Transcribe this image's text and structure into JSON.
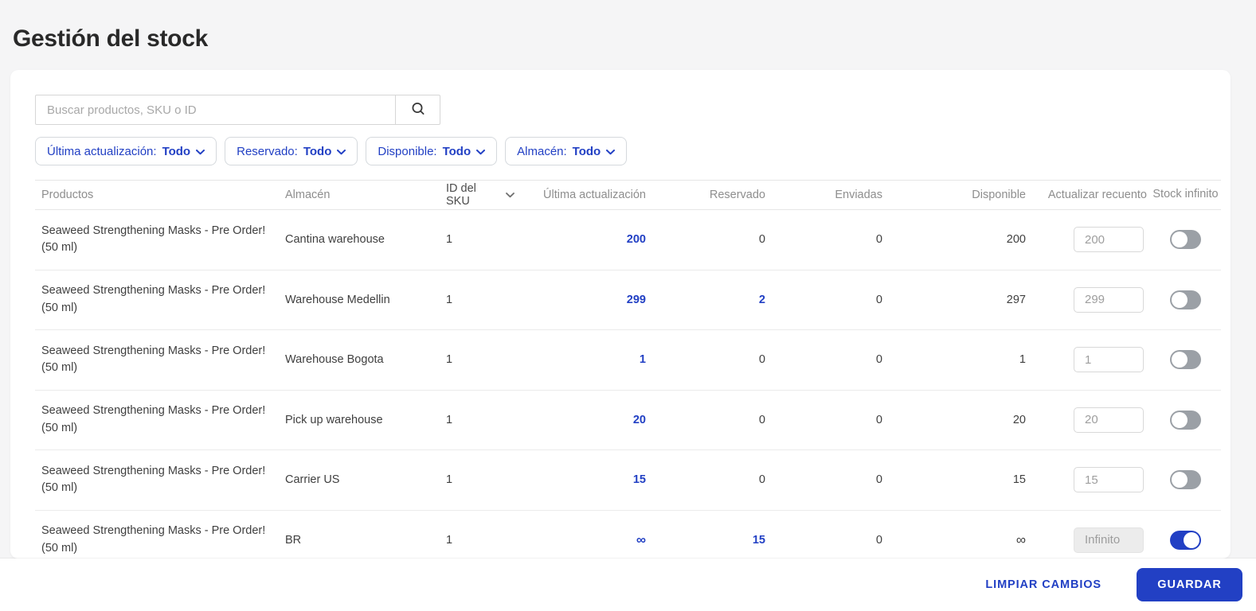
{
  "colors": {
    "accent": "#2240c4",
    "toggle-off": "#9ba0a6"
  },
  "icons": {
    "search": "magnifier-icon",
    "filter_caret": "chevron-down-icon",
    "sort": "chevron-down-icon"
  },
  "page": {
    "title": "Gestión del stock"
  },
  "search": {
    "placeholder": "Buscar productos, SKU o ID"
  },
  "filters": [
    {
      "label": "Última actualización:",
      "value": "Todo"
    },
    {
      "label": "Reservado:",
      "value": "Todo"
    },
    {
      "label": "Disponible:",
      "value": "Todo"
    },
    {
      "label": "Almacén:",
      "value": "Todo"
    }
  ],
  "table": {
    "columns": [
      "Productos",
      "Almacén",
      "ID del SKU",
      "Última actualización",
      "Reservado",
      "Enviadas",
      "Disponible",
      "Actualizar recuento",
      "Stock infinito"
    ],
    "rows": [
      {
        "product": "Seaweed Strengthening Masks - Pre Order! (50 ml)",
        "warehouse": "Cantina warehouse",
        "sku": "1",
        "last_update": "200",
        "reserved": "0",
        "shipped": "0",
        "available": "200",
        "count": "200",
        "infinite_stock": false
      },
      {
        "product": "Seaweed Strengthening Masks - Pre Order! (50 ml)",
        "warehouse": "Warehouse Medellin",
        "sku": "1",
        "last_update": "299",
        "reserved": "2",
        "shipped": "0",
        "available": "297",
        "count": "299",
        "infinite_stock": false
      },
      {
        "product": "Seaweed Strengthening Masks - Pre Order! (50 ml)",
        "warehouse": "Warehouse Bogota",
        "sku": "1",
        "last_update": "1",
        "reserved": "0",
        "shipped": "0",
        "available": "1",
        "count": "1",
        "infinite_stock": false
      },
      {
        "product": "Seaweed Strengthening Masks - Pre Order! (50 ml)",
        "warehouse": "Pick up warehouse",
        "sku": "1",
        "last_update": "20",
        "reserved": "0",
        "shipped": "0",
        "available": "20",
        "count": "20",
        "infinite_stock": false
      },
      {
        "product": "Seaweed Strengthening Masks - Pre Order! (50 ml)",
        "warehouse": "Carrier US",
        "sku": "1",
        "last_update": "15",
        "reserved": "0",
        "shipped": "0",
        "available": "15",
        "count": "15",
        "infinite_stock": false
      },
      {
        "product": "Seaweed Strengthening Masks - Pre Order! (50 ml)",
        "warehouse": "BR",
        "sku": "1",
        "last_update": "∞",
        "reserved": "15",
        "shipped": "0",
        "available": "∞",
        "count": "Infinito",
        "infinite_stock": true
      }
    ]
  },
  "footer": {
    "clear_label": "LIMPIAR CAMBIOS",
    "save_label": "GUARDAR"
  }
}
